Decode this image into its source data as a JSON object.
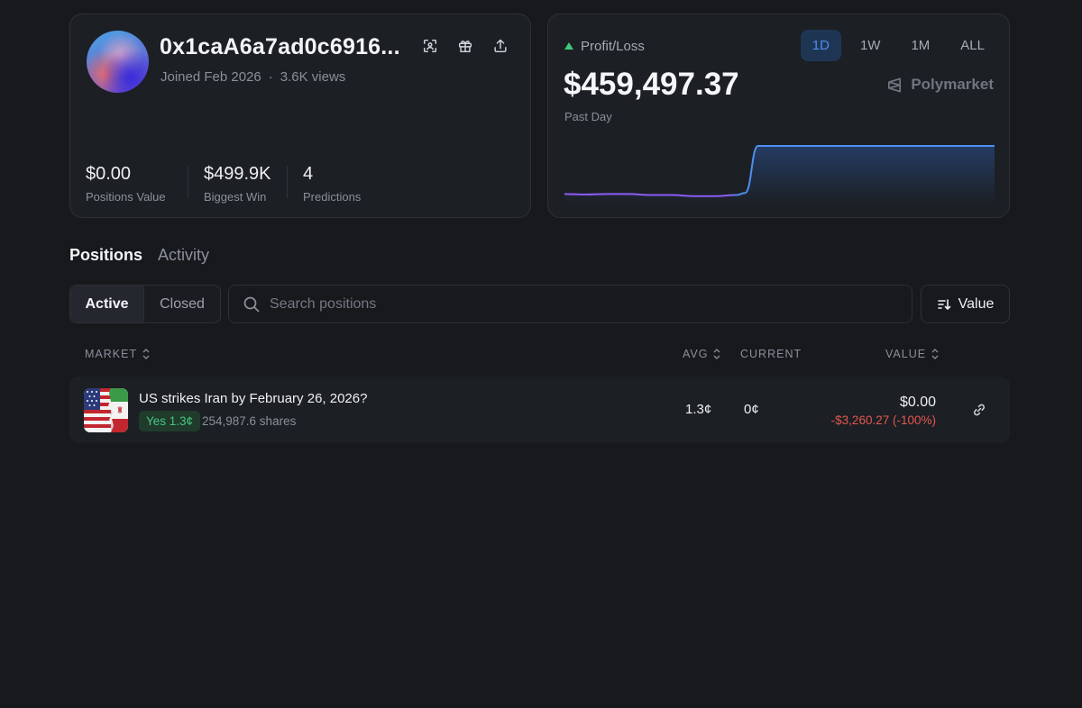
{
  "profile": {
    "username": "0x1caA6a7ad0c6916...",
    "joined": "Joined Feb 2026",
    "separator": "·",
    "views": "3.6K views",
    "icons": [
      "qr-scan-icon",
      "gift-icon",
      "share-icon"
    ],
    "stats": [
      {
        "value": "$0.00",
        "label": "Positions Value"
      },
      {
        "value": "$499.9K",
        "label": "Biggest Win"
      },
      {
        "value": "4",
        "label": "Predictions"
      }
    ]
  },
  "pnl": {
    "label": "Profit/Loss",
    "value": "$459,497.37",
    "period": "Past Day",
    "brand": "Polymarket",
    "ranges": [
      "1D",
      "1W",
      "1M",
      "ALL"
    ],
    "active_range": "1D",
    "colors": {
      "up": "#3ec97a",
      "line_before": "#8b5cf6",
      "line_after": "#4d8ff0"
    }
  },
  "chart_data": {
    "type": "line",
    "title": "",
    "xlabel": "",
    "ylabel": "",
    "x": [
      0,
      5,
      10,
      15,
      20,
      25,
      30,
      35,
      40,
      42,
      45,
      50,
      55,
      60,
      65,
      70,
      75,
      80,
      85,
      90,
      95,
      100
    ],
    "values": [
      8,
      7,
      8,
      8,
      6,
      6,
      4,
      4,
      6,
      10,
      100,
      100,
      100,
      100,
      100,
      100,
      100,
      100,
      100,
      100,
      100,
      100
    ],
    "xlim": [
      0,
      100
    ],
    "ylim": [
      0,
      100
    ],
    "grid": false,
    "legend": "none"
  },
  "tabs": {
    "positions": "Positions",
    "activity": "Activity"
  },
  "filter": {
    "active": "Active",
    "closed": "Closed",
    "search_placeholder": "Search positions",
    "sort_label": "Value"
  },
  "table": {
    "headers": {
      "market": "MARKET",
      "avg": "AVG",
      "current": "CURRENT",
      "value": "VALUE"
    },
    "rows": [
      {
        "title": "US strikes Iran by February 26, 2026?",
        "outcome": "Yes 1.3¢",
        "shares": "254,987.6 shares",
        "avg": "1.3¢",
        "current": "0¢",
        "value": "$0.00",
        "change": "-$3,260.27 (-100%)"
      }
    ]
  }
}
